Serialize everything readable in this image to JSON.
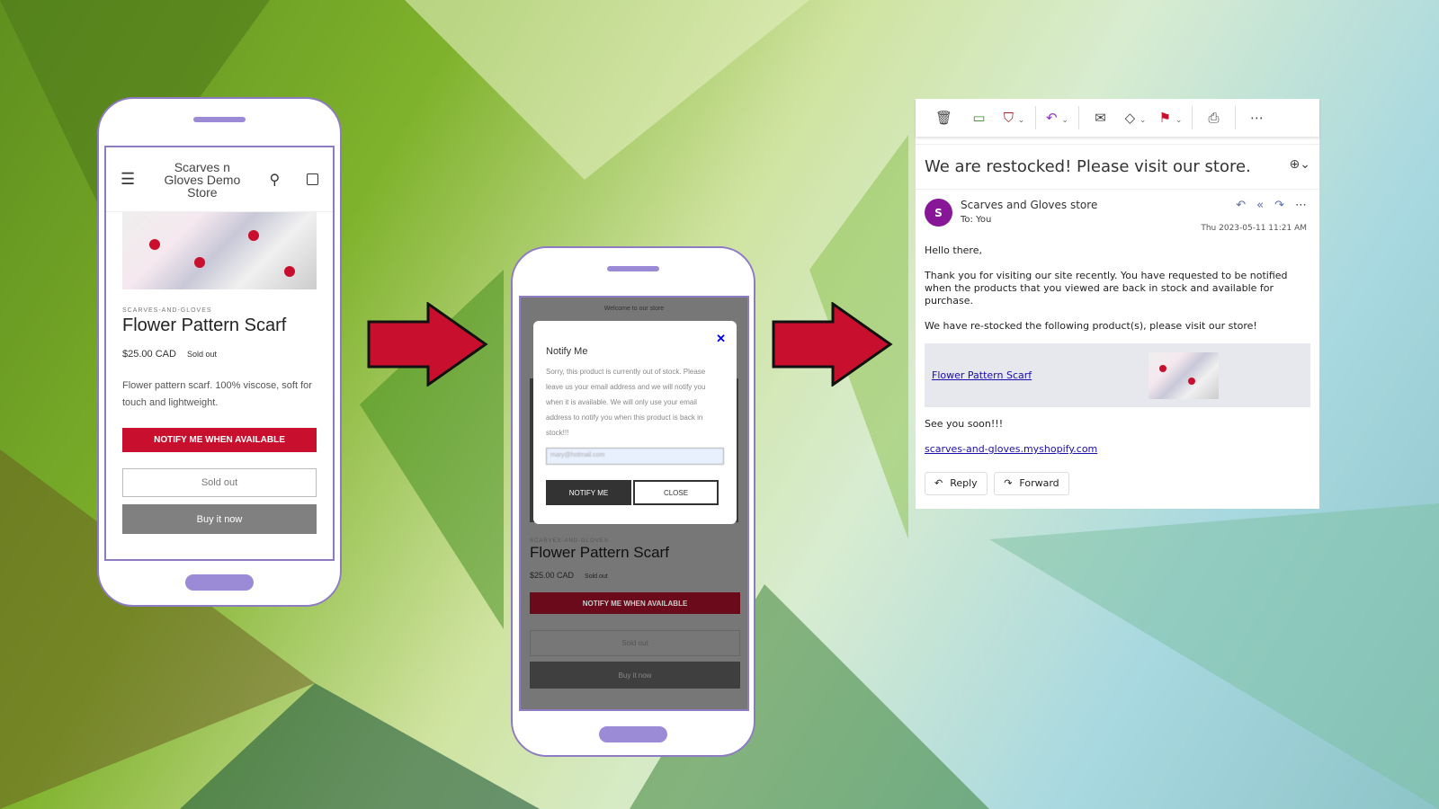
{
  "colors": {
    "accent": "#c8102e",
    "phone_border": "#8e7cc3",
    "avatar": "#881798"
  },
  "phone1": {
    "store_name": "Scarves n Gloves Demo Store",
    "vendor": "SCARVES-AND-GLOVES",
    "title": "Flower Pattern Scarf",
    "price": "$25.00 CAD",
    "badge": "Sold out",
    "description": "Flower pattern scarf. 100% viscose, soft for touch and lightweight.",
    "notify_button": "NOTIFY ME WHEN AVAILABLE",
    "soldout_button": "Sold out",
    "buy_button": "Buy it now",
    "icons": [
      "menu-icon",
      "search-icon",
      "cart-icon"
    ]
  },
  "phone2": {
    "announcement": "Welcome to our store",
    "modal": {
      "title": "Notify Me",
      "text": "Sorry, this product is currently out of stock. Please leave us your email address and we will notify you when it is available. We will only use your email address to notify you when this product is back in stock!!!",
      "email_value": "mary@hotmail.com",
      "notify_button": "NOTIFY ME",
      "close_button": "CLOSE"
    },
    "vendor": "SCARVES-AND-GLOVES",
    "title": "Flower Pattern Scarf",
    "price": "$25.00 CAD",
    "badge": "Sold out",
    "notify_button": "NOTIFY ME WHEN AVAILABLE",
    "soldout_button": "Sold out",
    "buy_button": "Buy it now"
  },
  "email": {
    "toolbar": [
      "trash-icon",
      "archive-icon",
      "report-icon",
      "reply-icon",
      "read-icon",
      "tag-icon",
      "flag-icon",
      "print-icon",
      "more-icon"
    ],
    "subject": "We are restocked! Please visit our store.",
    "avatar_letter": "S",
    "sender": "Scarves and Gloves store",
    "to": "To:  You",
    "date": "Thu 2023-05-11 11:21 AM",
    "greeting": "Hello there,",
    "para1": "Thank you for visiting our site recently. You have requested to be notified when the products that you viewed are back in stock and available for purchase.",
    "para2": "We have re-stocked the following product(s), please visit our store!",
    "product_link": "Flower Pattern Scarf",
    "signoff": "See you soon!!!",
    "store_link": "scarves-and-gloves.myshopify.com",
    "reply": "Reply",
    "forward": "Forward"
  }
}
